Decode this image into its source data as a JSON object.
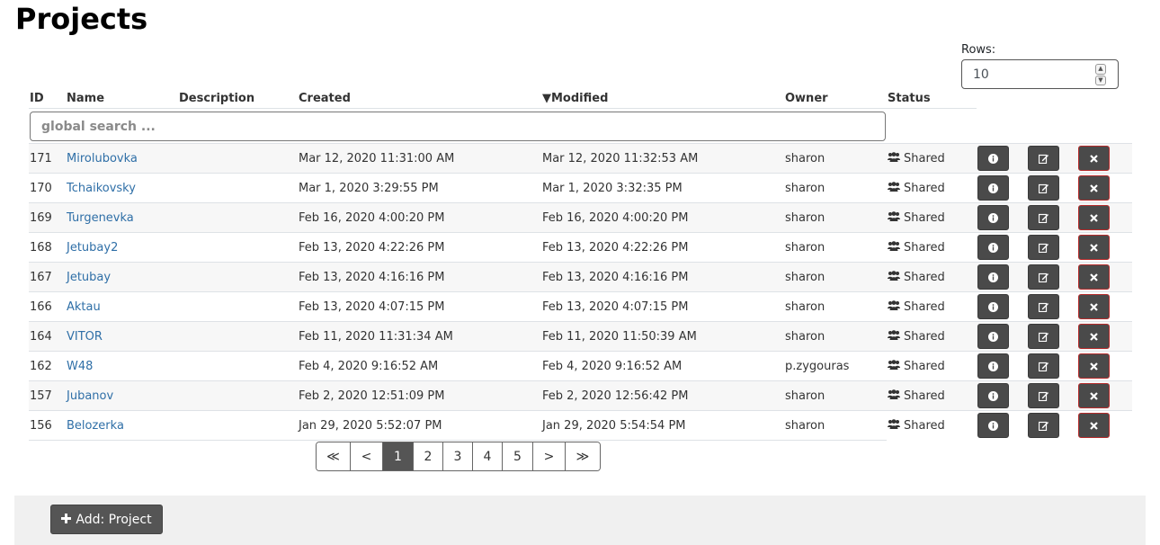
{
  "page": {
    "title": "Projects"
  },
  "rows_control": {
    "label": "Rows:",
    "value": "10"
  },
  "table": {
    "headers": {
      "id": "ID",
      "name": "Name",
      "description": "Description",
      "created": "Created",
      "modified": "▼Modified",
      "owner": "Owner",
      "status": "Status"
    },
    "search_placeholder": "global search ...",
    "rows": [
      {
        "id": "171",
        "name": "Mirolubovka",
        "description": "",
        "created": "Mar 12, 2020 11:31:00 AM",
        "modified": "Mar 12, 2020 11:32:53 AM",
        "owner": "sharon",
        "status": "Shared"
      },
      {
        "id": "170",
        "name": "Tchaikovsky",
        "description": "",
        "created": "Mar 1, 2020 3:29:55 PM",
        "modified": "Mar 1, 2020 3:32:35 PM",
        "owner": "sharon",
        "status": "Shared"
      },
      {
        "id": "169",
        "name": "Turgenevka",
        "description": "",
        "created": "Feb 16, 2020 4:00:20 PM",
        "modified": "Feb 16, 2020 4:00:20 PM",
        "owner": "sharon",
        "status": "Shared"
      },
      {
        "id": "168",
        "name": "Jetubay2",
        "description": "",
        "created": "Feb 13, 2020 4:22:26 PM",
        "modified": "Feb 13, 2020 4:22:26 PM",
        "owner": "sharon",
        "status": "Shared"
      },
      {
        "id": "167",
        "name": "Jetubay",
        "description": "",
        "created": "Feb 13, 2020 4:16:16 PM",
        "modified": "Feb 13, 2020 4:16:16 PM",
        "owner": "sharon",
        "status": "Shared"
      },
      {
        "id": "166",
        "name": "Aktau",
        "description": "",
        "created": "Feb 13, 2020 4:07:15 PM",
        "modified": "Feb 13, 2020 4:07:15 PM",
        "owner": "sharon",
        "status": "Shared"
      },
      {
        "id": "164",
        "name": "VITOR",
        "description": "",
        "created": "Feb 11, 2020 11:31:34 AM",
        "modified": "Feb 11, 2020 11:50:39 AM",
        "owner": "sharon",
        "status": "Shared"
      },
      {
        "id": "162",
        "name": "W48",
        "description": "",
        "created": "Feb 4, 2020 9:16:52 AM",
        "modified": "Feb 4, 2020 9:16:52 AM",
        "owner": "p.zygouras",
        "status": "Shared"
      },
      {
        "id": "157",
        "name": "Jubanov",
        "description": "",
        "created": "Feb 2, 2020 12:51:09 PM",
        "modified": "Feb 2, 2020 12:56:42 PM",
        "owner": "sharon",
        "status": "Shared"
      },
      {
        "id": "156",
        "name": "Belozerka",
        "description": "",
        "created": "Jan 29, 2020 5:52:07 PM",
        "modified": "Jan 29, 2020 5:54:54 PM",
        "owner": "sharon",
        "status": "Shared"
      }
    ],
    "row_actions": {
      "info_icon": "info-circle-icon",
      "edit_icon": "edit-icon",
      "delete_icon": "close-icon"
    },
    "status_icon": "users-icon"
  },
  "pagination": {
    "items": [
      {
        "label": "≪",
        "name": "first"
      },
      {
        "label": "<",
        "name": "prev"
      },
      {
        "label": "1",
        "name": "1"
      },
      {
        "label": "2",
        "name": "2"
      },
      {
        "label": "3",
        "name": "3"
      },
      {
        "label": "4",
        "name": "4"
      },
      {
        "label": "5",
        "name": "5"
      },
      {
        "label": ">",
        "name": "next"
      },
      {
        "label": "≫",
        "name": "last"
      }
    ],
    "active": "1"
  },
  "footer": {
    "add_label": "Add: Project",
    "add_icon": "plus-icon"
  },
  "colors": {
    "link": "#2f6fa7",
    "button": "#4a4a4a",
    "delete_border": "#b52b2b",
    "page_active": "#555555"
  }
}
